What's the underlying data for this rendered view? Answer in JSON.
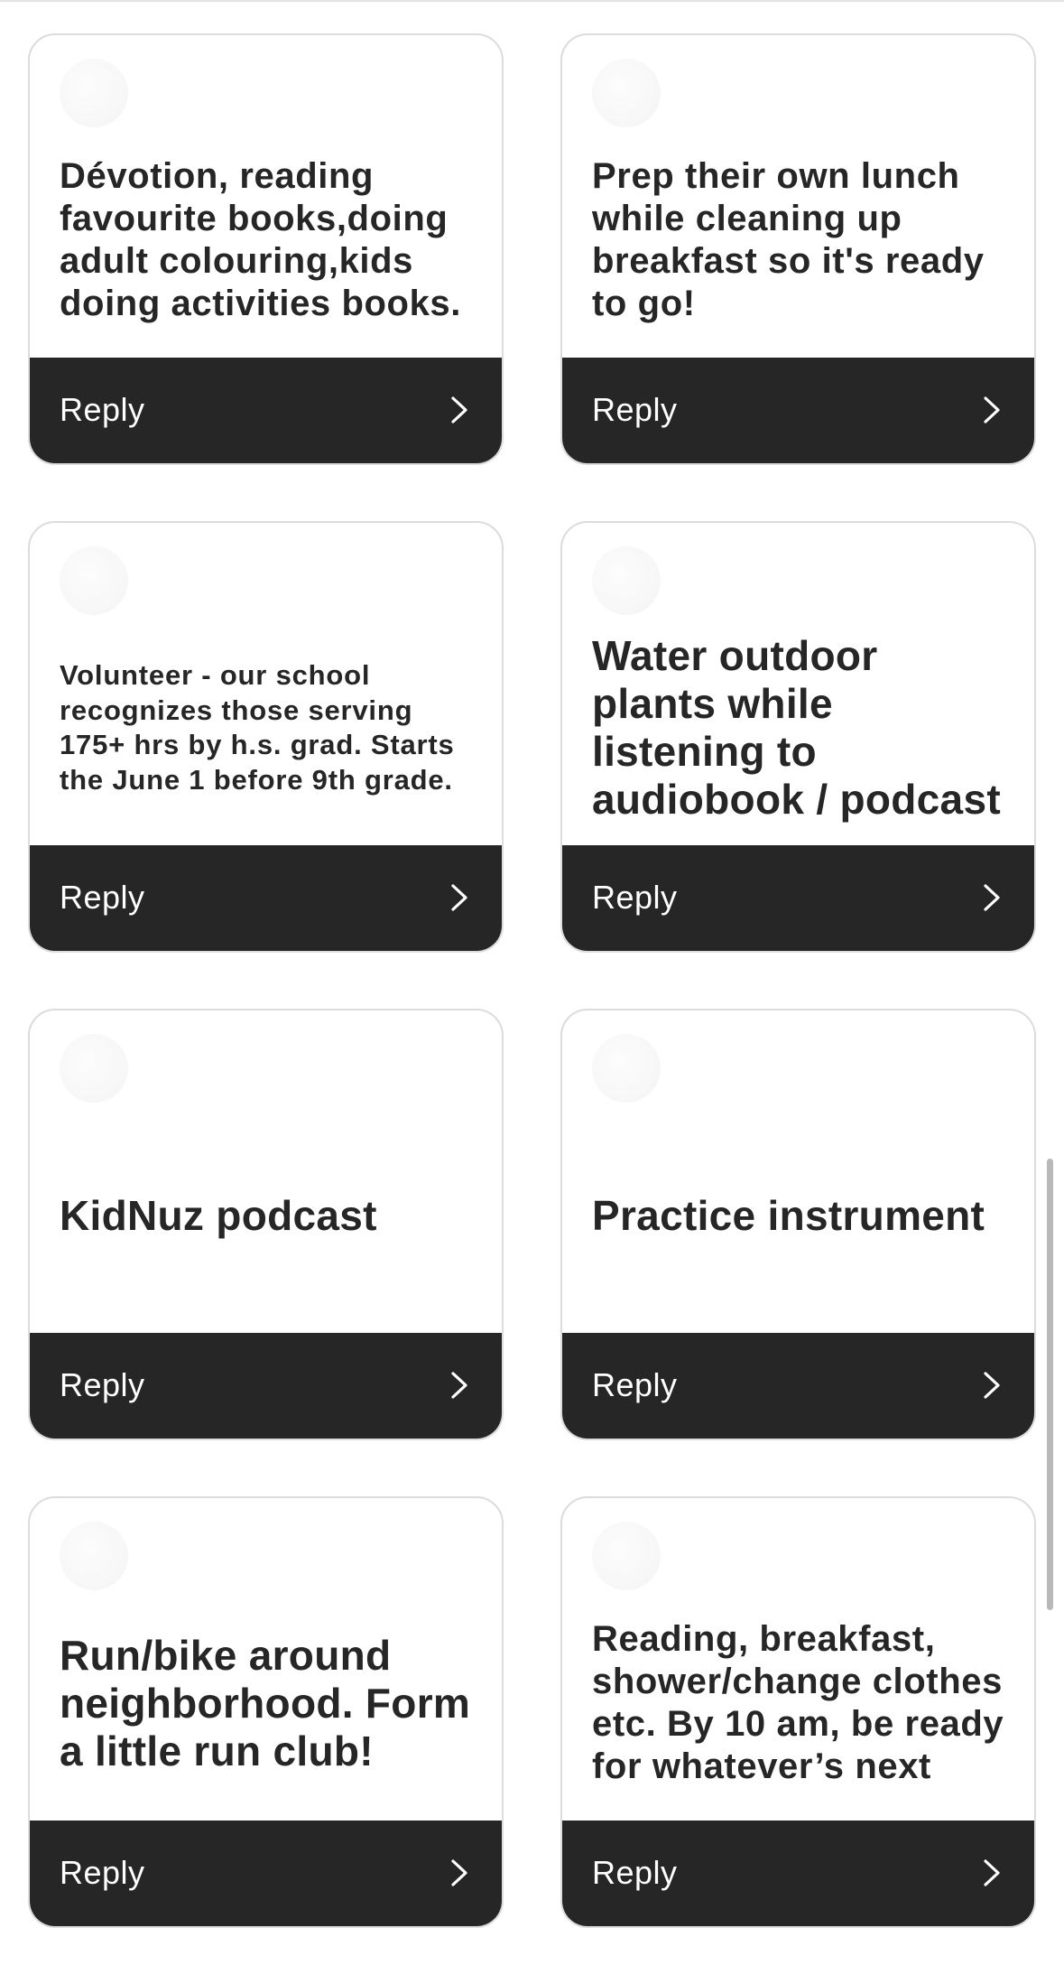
{
  "cards": [
    {
      "text": "Dévotion, reading favourite books,doing adult colouring,kids doing activities books.",
      "size": "medium",
      "reply": "Reply"
    },
    {
      "text": "Prep their own lunch while cleaning up breakfast so it's ready to go!",
      "size": "medium",
      "reply": "Reply"
    },
    {
      "text": "Volunteer - our school recognizes those serving 175+ hrs by h.s. grad. Starts the June 1 before 9th grade.",
      "size": "small",
      "reply": "Reply"
    },
    {
      "text": "Water outdoor plants while listening to audiobook / podcast",
      "size": "large",
      "reply": "Reply"
    },
    {
      "text": "KidNuz podcast",
      "size": "large",
      "reply": "Reply"
    },
    {
      "text": "Practice instrument",
      "size": "large",
      "reply": "Reply"
    },
    {
      "text": "Run/bike around neighborhood. Form a little run club!",
      "size": "large",
      "reply": "Reply"
    },
    {
      "text": "Reading, breakfast, shower/change clothes etc. By 10 am, be ready for whatever’s next",
      "size": "medium",
      "reply": "Reply"
    }
  ],
  "icons": {
    "reply_arrow": "chevron-right-icon"
  },
  "colors": {
    "reply_bar": "#262626",
    "reply_text": "#ffffff",
    "card_border": "#dcdcdc",
    "body_text": "#262626"
  }
}
